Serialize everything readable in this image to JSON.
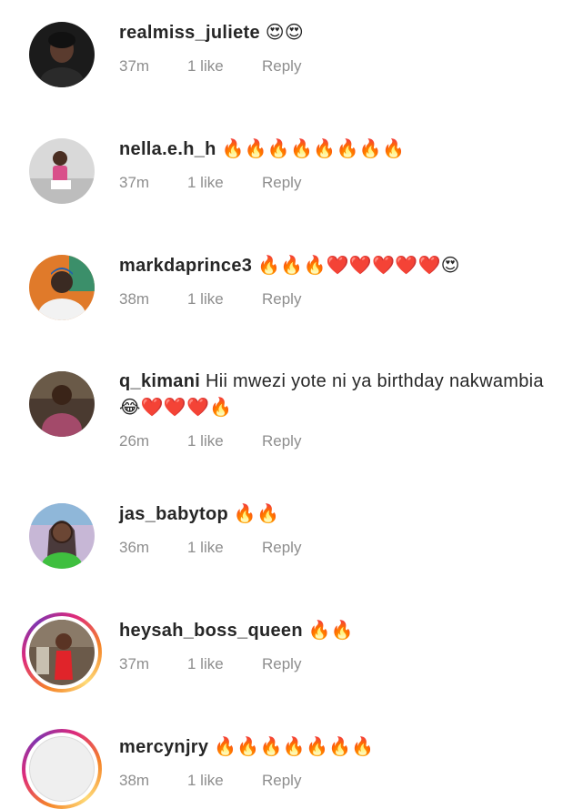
{
  "comments": [
    {
      "username": "realmiss_juliete",
      "text": "",
      "emoji": "😍😍",
      "time": "37m",
      "likes": "1 like",
      "reply": "Reply",
      "avatar_bg": "#1b1b1b",
      "avatar_fg": "#5a3b2e"
    },
    {
      "username": "nella.e.h_h",
      "text": "",
      "emoji": "🔥🔥🔥🔥🔥🔥🔥🔥",
      "time": "37m",
      "likes": "1 like",
      "reply": "Reply",
      "avatar_bg": "#d9d9d9",
      "avatar_fg": "#d94f8a"
    },
    {
      "username": "markdaprince3",
      "text": "",
      "emoji": "🔥🔥🔥❤️❤️❤️❤️❤️😍",
      "time": "38m",
      "likes": "1 like",
      "reply": "Reply",
      "avatar_bg": "#e07a2a",
      "avatar_fg": "#3a2a22"
    },
    {
      "username": "q_kimani",
      "text": "Hii mwezi yote ni ya birthday nakwambia",
      "emoji": "😂❤️❤️❤️🔥",
      "time": "26m",
      "likes": "1 like",
      "reply": "Reply",
      "avatar_bg": "#4a3a30",
      "avatar_fg": "#a34a6a"
    },
    {
      "username": "jas_babytop",
      "text": "",
      "emoji": "🔥🔥",
      "time": "36m",
      "likes": "1 like",
      "reply": "Reply",
      "avatar_bg": "#c7b7d6",
      "avatar_fg": "#5b3a2e"
    },
    {
      "username": "heysah_boss_queen",
      "text": "",
      "emoji": "🔥🔥",
      "time": "37m",
      "likes": "1 like",
      "reply": "Reply",
      "avatar_bg": "#6b5a4a",
      "avatar_fg": "#e0242a"
    },
    {
      "username": "mercynjry",
      "text": "",
      "emoji": "🔥🔥🔥🔥🔥🔥🔥",
      "time": "38m",
      "likes": "1 like",
      "reply": "Reply",
      "avatar_bg": "#efefef",
      "avatar_fg": "#efefef"
    }
  ]
}
